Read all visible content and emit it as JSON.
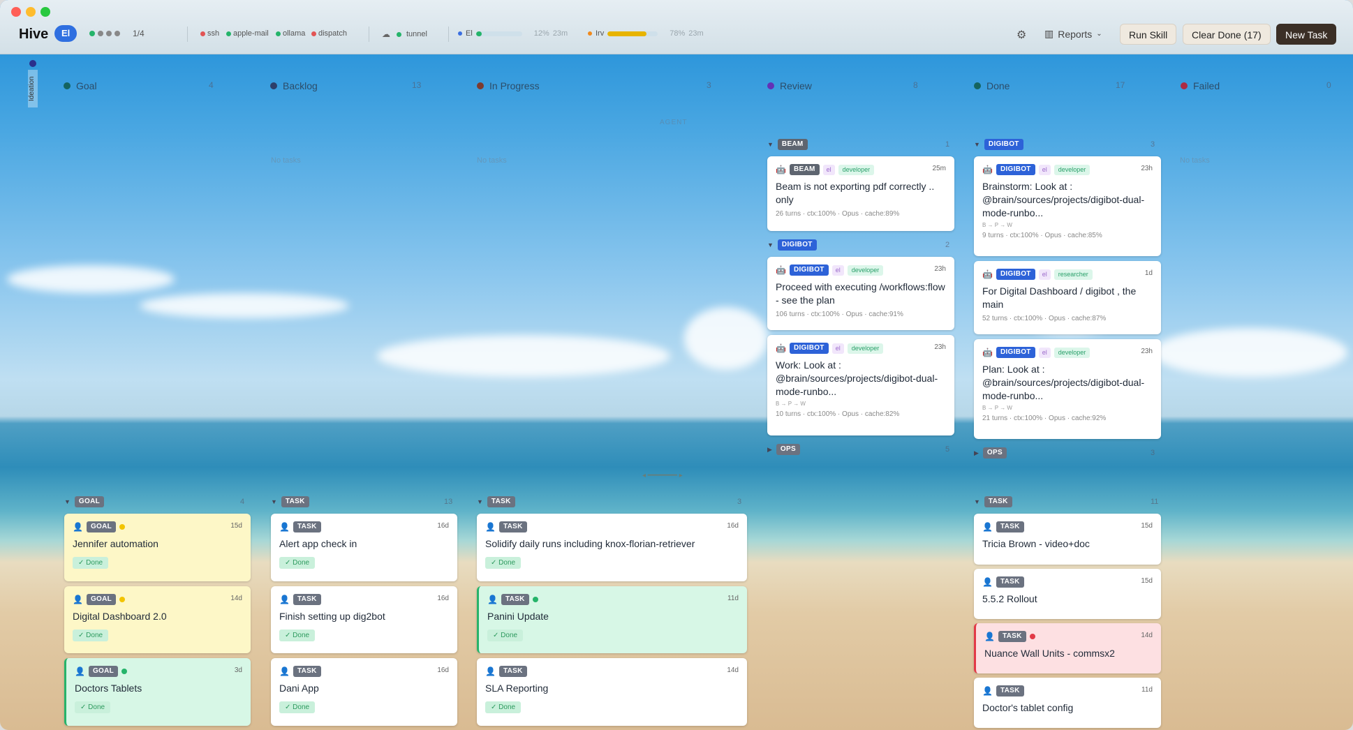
{
  "app": {
    "title": "Hive",
    "user_badge": "El",
    "page": "1/4"
  },
  "services": [
    {
      "label": "ssh",
      "color": "#e25555"
    },
    {
      "label": "apple-mail",
      "color": "#25b46a"
    },
    {
      "label": "ollama",
      "color": "#25b46a"
    },
    {
      "label": "dispatch",
      "color": "#e25555"
    }
  ],
  "tunnel": {
    "label": "tunnel",
    "color": "#25b46a"
  },
  "meters": [
    {
      "label": "El",
      "dot": "#3b6fe0",
      "fill": "#25b46a",
      "percent_text": "12%",
      "percent": 12,
      "age": "23m"
    },
    {
      "label": "Irv",
      "dot": "#f08a1d",
      "fill": "#e7b400",
      "percent_text": "78%",
      "percent": 78,
      "age": "23m"
    }
  ],
  "toolbar": {
    "reports": "Reports",
    "run_skill": "Run Skill",
    "clear_done": "Clear Done (17)",
    "new_task": "New Task"
  },
  "rail": {
    "label": "Ideation"
  },
  "columns": [
    {
      "label": "Goal",
      "count": "4",
      "color": "#0f5a4a"
    },
    {
      "label": "Backlog",
      "count": "13",
      "color": "#2b2f57"
    },
    {
      "label": "In Progress",
      "count": "3",
      "color": "#8a2b12"
    },
    {
      "label": "Review",
      "count": "8",
      "color": "#6b1fb0"
    },
    {
      "label": "Done",
      "count": "17",
      "color": "#0f5a4a"
    },
    {
      "label": "Failed",
      "count": "0",
      "color": "#c0182a"
    }
  ],
  "agent_label": "AGENT",
  "empty_label": "No tasks",
  "groups": {
    "beam": {
      "tag": "BEAM",
      "count": "1"
    },
    "digibot_review": {
      "tag": "DIGIBOT",
      "count": "2"
    },
    "ops_review": {
      "tag": "OPS",
      "count": "5"
    },
    "digibot_done": {
      "tag": "DIGIBOT",
      "count": "3"
    },
    "ops_done": {
      "tag": "OPS",
      "count": "3"
    },
    "goal": {
      "tag": "GOAL",
      "count": "4"
    },
    "task_backlog": {
      "tag": "TASK",
      "count": "13"
    },
    "task_progress": {
      "tag": "TASK",
      "count": "3"
    },
    "task_done": {
      "tag": "TASK",
      "count": "11"
    }
  },
  "review_cards": [
    {
      "tag": "BEAM",
      "el": "el",
      "role": "developer",
      "age": "25m",
      "title": "Beam is not exporting pdf correctly .. only",
      "meta": "26 turns · ctx:100% · Opus · cache:89%"
    },
    {
      "tag": "DIGIBOT",
      "el": "el",
      "role": "developer",
      "age": "23h",
      "title": "Proceed with executing /workflows:flow - see the plan",
      "meta": "106 turns · ctx:100% · Opus · cache:91%"
    },
    {
      "tag": "DIGIBOT",
      "el": "el",
      "role": "developer",
      "age": "23h",
      "title": "Work: Look at : @brain/sources/projects/digibot-dual-mode-runbo...",
      "flow": "B → P → W",
      "meta": "10 turns · ctx:100% · Opus · cache:82%"
    }
  ],
  "done_agent_cards": [
    {
      "tag": "DIGIBOT",
      "el": "el",
      "role": "developer",
      "age": "23h",
      "title": "Brainstorm: Look at : @brain/sources/projects/digibot-dual-mode-runbo...",
      "flow": "B → P → W",
      "meta": "9 turns · ctx:100% · Opus · cache:85%"
    },
    {
      "tag": "DIGIBOT",
      "el": "el",
      "role": "researcher",
      "age": "1d",
      "title": "For Digital Dashboard / digibot , the main",
      "meta": "52 turns · ctx:100% · Opus · cache:87%"
    },
    {
      "tag": "DIGIBOT",
      "el": "el",
      "role": "developer",
      "age": "23h",
      "title": "Plan: Look at : @brain/sources/projects/digibot-dual-mode-runbo...",
      "flow": "B → P → W",
      "meta": "21 turns · ctx:100% · Opus · cache:92%"
    }
  ],
  "done_label": "✓ Done",
  "goal_cards": [
    {
      "tag": "GOAL",
      "age": "15d",
      "title": "Jennifer automation"
    },
    {
      "tag": "GOAL",
      "age": "14d",
      "title": "Digital Dashboard 2.0"
    },
    {
      "tag": "GOAL",
      "age": "3d",
      "title": "Doctors Tablets"
    }
  ],
  "backlog_cards": [
    {
      "tag": "TASK",
      "age": "16d",
      "title": "Alert app check in"
    },
    {
      "tag": "TASK",
      "age": "16d",
      "title": "Finish setting up dig2bot"
    },
    {
      "tag": "TASK",
      "age": "16d",
      "title": "Dani App"
    }
  ],
  "progress_cards": [
    {
      "tag": "TASK",
      "age": "16d",
      "title": "Solidify daily runs including knox-florian-retriever"
    },
    {
      "tag": "TASK",
      "age": "11d",
      "title": "Panini Update"
    },
    {
      "tag": "TASK",
      "age": "14d",
      "title": "SLA Reporting"
    }
  ],
  "done_task_cards": [
    {
      "tag": "TASK",
      "age": "15d",
      "title": "Tricia Brown - video+doc"
    },
    {
      "tag": "TASK",
      "age": "15d",
      "title": "5.5.2 Rollout"
    },
    {
      "tag": "TASK",
      "age": "14d",
      "title": "Nuance Wall Units - commsx2"
    },
    {
      "tag": "TASK",
      "age": "11d",
      "title": "Doctor's tablet config"
    }
  ]
}
